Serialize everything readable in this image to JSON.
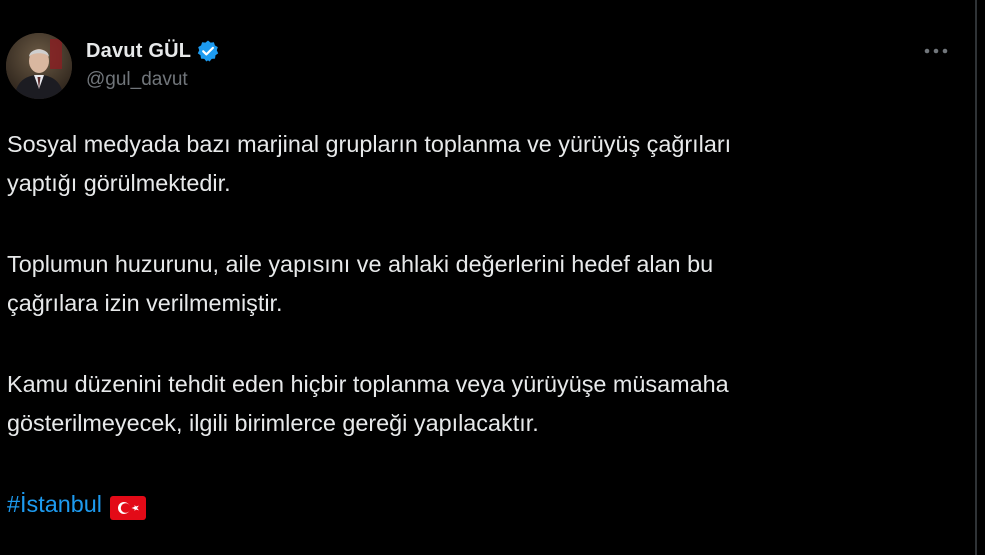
{
  "user": {
    "display_name": "Davut GÜL",
    "handle": "@gul_davut",
    "verified_icon": "verified-badge-icon",
    "avatar_icon": "profile-avatar"
  },
  "menu": {
    "more_icon": "more-options-icon"
  },
  "tweet": {
    "paragraphs": [
      [
        "Sosyal medyada bazı marjinal grupların toplanma ve yürüyüş çağrıları",
        "yaptığı görülmektedir."
      ],
      [
        "Toplumun huzurunu, aile yapısını ve ahlaki değerlerini hedef alan bu",
        "çağrılara izin verilmemiştir."
      ],
      [
        "Kamu düzenini tehdit eden hiçbir toplanma veya yürüyüşe müsamaha",
        "gösterilmeyecek, ilgili birimlerce gereği yapılacaktır."
      ]
    ],
    "hashtag": "#İstanbul",
    "flag_icon": "turkey-flag-emoji"
  },
  "colors": {
    "background": "#000000",
    "text": "#e7e9ea",
    "secondary_text": "#71767b",
    "accent": "#1d9bf0",
    "flag_red": "#e30a17"
  }
}
